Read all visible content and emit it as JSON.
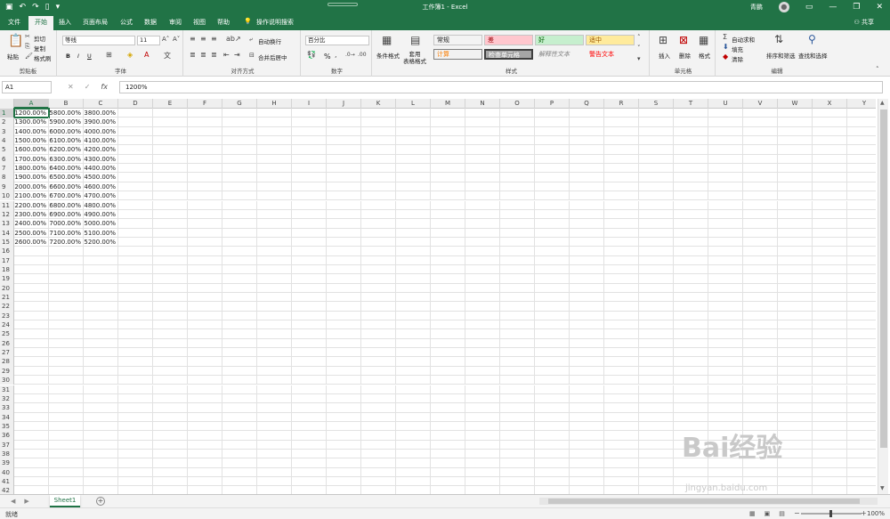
{
  "window": {
    "title": "工作簿1 - Excel",
    "user": "青鹏",
    "share_label": "共享"
  },
  "tabs": [
    {
      "label": "文件"
    },
    {
      "label": "开始",
      "active": true
    },
    {
      "label": "插入"
    },
    {
      "label": "页面布局"
    },
    {
      "label": "公式"
    },
    {
      "label": "数据"
    },
    {
      "label": "审阅"
    },
    {
      "label": "视图"
    },
    {
      "label": "帮助"
    },
    {
      "label": "操作说明搜索"
    }
  ],
  "ribbon": {
    "clipboard": {
      "label": "剪贴板",
      "paste": "粘贴",
      "cut": "剪切",
      "copy": "复制",
      "format_painter": "格式刷"
    },
    "font": {
      "label": "字体",
      "font_name": "等线",
      "font_size": "11",
      "bold": "B",
      "italic": "I",
      "underline": "U"
    },
    "alignment": {
      "label": "对齐方式",
      "wrap": "自动换行",
      "merge": "合并后居中"
    },
    "number": {
      "label": "数字",
      "format": "百分比",
      "percent": "%"
    },
    "styles": {
      "label": "样式",
      "conditional": "条件格式",
      "table": "套用\n表格格式",
      "cells": [
        {
          "text": "常规",
          "bg": "#ffffff",
          "color": "#222222"
        },
        {
          "text": "差",
          "bg": "#ffc7ce",
          "color": "#9c0006"
        },
        {
          "text": "好",
          "bg": "#c6efce",
          "color": "#006100"
        },
        {
          "text": "适中",
          "bg": "#ffeb9c",
          "color": "#9c5700"
        },
        {
          "text": "计算",
          "bg": "#f2f2f2",
          "color": "#fa7d00"
        },
        {
          "text": "检查单元格",
          "bg": "#a5a5a5",
          "color": "#ffffff"
        },
        {
          "text": "解释性文本",
          "bg": "#ffffff",
          "color": "#7f7f7f"
        },
        {
          "text": "警告文本",
          "bg": "#ffffff",
          "color": "#ff0000"
        }
      ]
    },
    "cells": {
      "label": "单元格",
      "insert": "插入",
      "delete": "删除",
      "format": "格式"
    },
    "editing": {
      "label": "编辑",
      "autosum": "自动求和",
      "fill": "填充",
      "clear": "清除",
      "sort": "排序和筛选",
      "find": "查找和选择"
    }
  },
  "formula_bar": {
    "name_box": "A1",
    "fx": "fx",
    "value": "1200%"
  },
  "columns": [
    "A",
    "B",
    "C",
    "D",
    "E",
    "F",
    "G",
    "H",
    "I",
    "J",
    "K",
    "L",
    "M",
    "N",
    "O",
    "P",
    "Q",
    "R",
    "S",
    "T",
    "U",
    "V",
    "W",
    "X",
    "Y"
  ],
  "rows": [
    {
      "n": "1",
      "cells": [
        "1200.00%",
        "5800.00%",
        "3800.00%"
      ]
    },
    {
      "n": "2",
      "cells": [
        "1300.00%",
        "5900.00%",
        "3900.00%"
      ]
    },
    {
      "n": "3",
      "cells": [
        "1400.00%",
        "6000.00%",
        "4000.00%"
      ]
    },
    {
      "n": "4",
      "cells": [
        "1500.00%",
        "6100.00%",
        "4100.00%"
      ]
    },
    {
      "n": "5",
      "cells": [
        "1600.00%",
        "6200.00%",
        "4200.00%"
      ]
    },
    {
      "n": "6",
      "cells": [
        "1700.00%",
        "6300.00%",
        "4300.00%"
      ]
    },
    {
      "n": "7",
      "cells": [
        "1800.00%",
        "6400.00%",
        "4400.00%"
      ]
    },
    {
      "n": "8",
      "cells": [
        "1900.00%",
        "6500.00%",
        "4500.00%"
      ]
    },
    {
      "n": "9",
      "cells": [
        "2000.00%",
        "6600.00%",
        "4600.00%"
      ]
    },
    {
      "n": "10",
      "cells": [
        "2100.00%",
        "6700.00%",
        "4700.00%"
      ]
    },
    {
      "n": "11",
      "cells": [
        "2200.00%",
        "6800.00%",
        "4800.00%"
      ]
    },
    {
      "n": "12",
      "cells": [
        "2300.00%",
        "6900.00%",
        "4900.00%"
      ]
    },
    {
      "n": "13",
      "cells": [
        "2400.00%",
        "7000.00%",
        "5000.00%"
      ]
    },
    {
      "n": "14",
      "cells": [
        "2500.00%",
        "7100.00%",
        "5100.00%"
      ]
    },
    {
      "n": "15",
      "cells": [
        "2600.00%",
        "7200.00%",
        "5200.00%"
      ]
    },
    {
      "n": "16",
      "cells": []
    },
    {
      "n": "17",
      "cells": []
    },
    {
      "n": "18",
      "cells": []
    },
    {
      "n": "19",
      "cells": []
    },
    {
      "n": "20",
      "cells": []
    },
    {
      "n": "21",
      "cells": []
    },
    {
      "n": "22",
      "cells": []
    },
    {
      "n": "23",
      "cells": []
    },
    {
      "n": "24",
      "cells": []
    },
    {
      "n": "25",
      "cells": []
    },
    {
      "n": "26",
      "cells": []
    },
    {
      "n": "27",
      "cells": []
    },
    {
      "n": "28",
      "cells": []
    },
    {
      "n": "29",
      "cells": []
    },
    {
      "n": "30",
      "cells": []
    },
    {
      "n": "31",
      "cells": []
    },
    {
      "n": "32",
      "cells": []
    },
    {
      "n": "33",
      "cells": []
    },
    {
      "n": "34",
      "cells": []
    },
    {
      "n": "35",
      "cells": []
    },
    {
      "n": "36",
      "cells": []
    },
    {
      "n": "37",
      "cells": []
    },
    {
      "n": "38",
      "cells": []
    },
    {
      "n": "39",
      "cells": []
    },
    {
      "n": "40",
      "cells": []
    },
    {
      "n": "41",
      "cells": []
    },
    {
      "n": "42",
      "cells": []
    }
  ],
  "sheet_tabs": [
    {
      "label": "Sheet1",
      "active": true
    }
  ],
  "status": {
    "ready": "就绪",
    "zoom": "100%"
  },
  "watermark": {
    "text": "Bai经验",
    "sub": "jingyan.baidu.com"
  },
  "colors": {
    "brand": "#217346"
  }
}
